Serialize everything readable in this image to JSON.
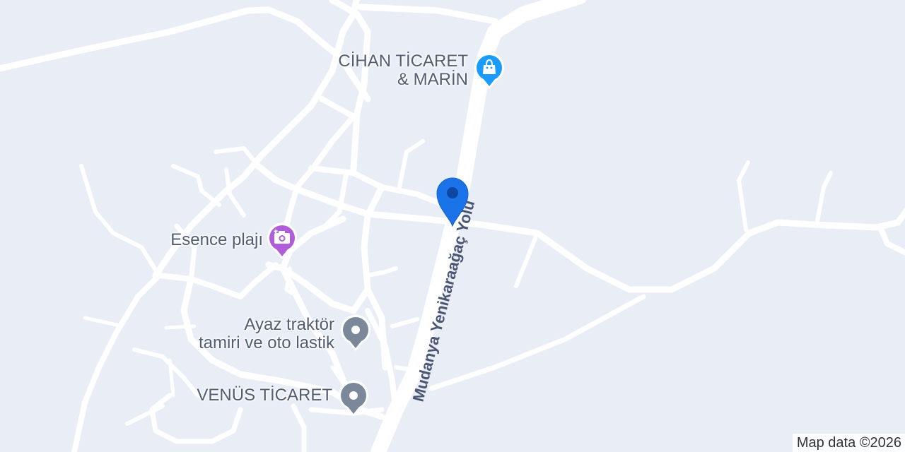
{
  "map": {
    "road_label": "Mudanya Yenikaraağaç Yolu",
    "attribution": "Map data ©2026"
  },
  "places": [
    {
      "name_lines": [
        "CİHAN TİCARET",
        "& MARİN"
      ],
      "type": "shopping",
      "icon": "shopping-bag-icon",
      "color": "#1a9bff"
    },
    {
      "name_lines": [
        "Esence plajı"
      ],
      "type": "tourist-attraction",
      "icon": "camera-icon",
      "color": "#b05ddc"
    },
    {
      "name_lines": [
        "Ayaz traktör",
        "tamiri ve oto lastik"
      ],
      "type": "generic",
      "icon": "generic-place-icon",
      "color": "#7a8899"
    },
    {
      "name_lines": [
        "VENÜS TİCARET"
      ],
      "type": "generic",
      "icon": "generic-place-icon",
      "color": "#7a8899"
    }
  ],
  "selected_marker": {
    "icon": "location-marker-icon",
    "color": "#1a73e8"
  }
}
